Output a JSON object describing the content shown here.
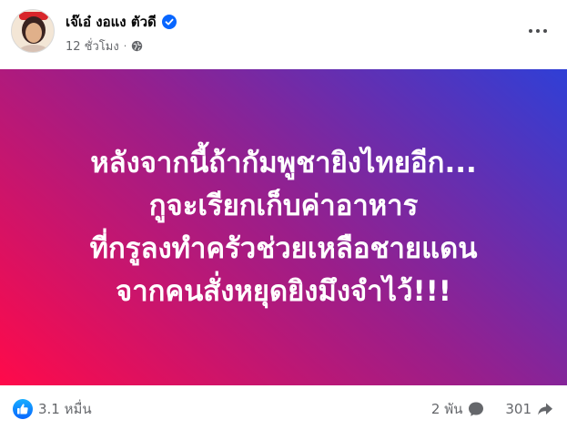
{
  "post": {
    "author_name": "เจ๊เอ๋ งอแง ตัวดี",
    "verified": true,
    "timestamp": "12 ชั่วโมง",
    "separator": "·",
    "privacy_icon": "globe-icon",
    "more_icon": "more-options-icon",
    "background_gradient": {
      "from": "#ff0a4a",
      "via": "#9b1e8a",
      "to": "#2f3fd6"
    },
    "text_lines": [
      "หลังจากนี้ถ้ากัมพูชายิงไทยอีก...",
      "กูจะเรียกเก็บค่าอาหาร",
      "ที่กรูลงทำครัวช่วยเหลือชายแดน",
      "จากคนสั่งหยุดยิงมึงจำไว้!!!"
    ]
  },
  "footer": {
    "reaction_icon": "like-icon",
    "reaction_count": "3.1 หมื่น",
    "comment_count": "2 พัน",
    "comment_icon": "comment-icon",
    "share_count": "301",
    "share_icon": "share-icon"
  },
  "colors": {
    "brand_blue": "#0866ff",
    "secondary_text": "#65676b"
  }
}
